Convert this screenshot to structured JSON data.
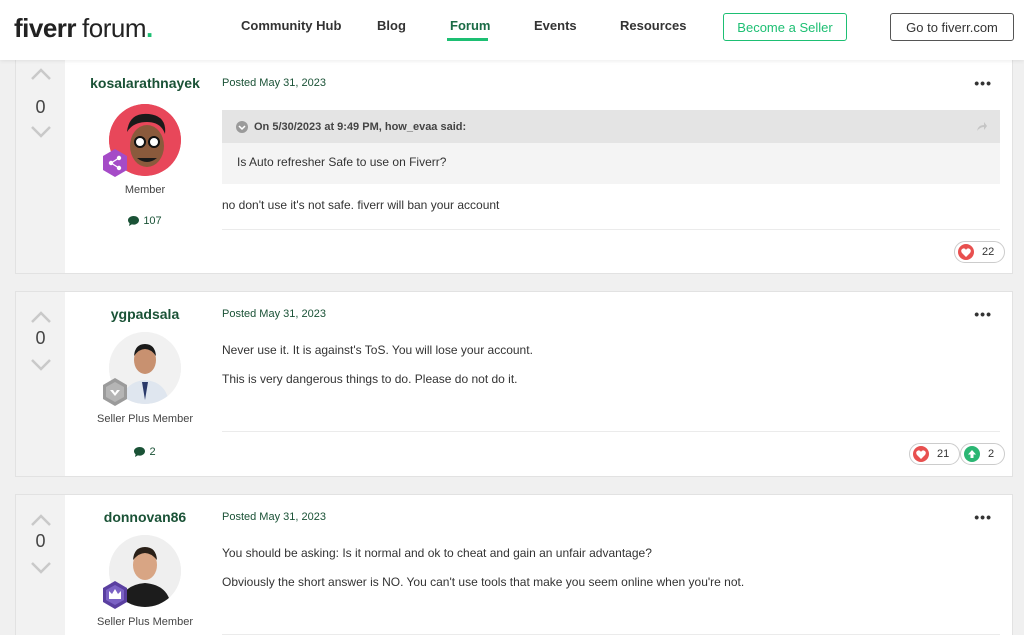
{
  "header": {
    "logo_main": "fiverr",
    "logo_sub": "forum",
    "logo_dot": ".",
    "nav": [
      "Community Hub",
      "Blog",
      "Forum",
      "Events",
      "Resources"
    ],
    "active_nav": "Forum",
    "become_seller": "Become a Seller",
    "go_fiverr": "Go to fiverr.com"
  },
  "colors": {
    "brand": "#1dbf73",
    "author": "#1a5236",
    "heart": "#e8504f",
    "upvote": "#2bb673"
  },
  "posts": [
    {
      "author": "kosalarathnayek",
      "votes": "0",
      "role": "Member",
      "post_count": "107",
      "posted": "Posted May 31, 2023",
      "quote": {
        "header": "On 5/30/2023 at 9:49 PM, how_evaa said:",
        "text": "Is Auto refresher Safe to use on Fiverr?"
      },
      "content": [
        "no don't use it's not safe. fiverr will ban your account"
      ],
      "reactions": {
        "heart": "22"
      }
    },
    {
      "author": "ygpadsala",
      "votes": "0",
      "role": "Seller Plus Member",
      "post_count": "2",
      "posted": "Posted May 31, 2023",
      "content": [
        "Never use it. It is against's ToS. You will lose your account.",
        "This is very dangerous things to do.  Please do not do it."
      ],
      "reactions": {
        "heart": "21",
        "upvote": "2"
      }
    },
    {
      "author": "donnovan86",
      "votes": "0",
      "role": "Seller Plus Member",
      "posted": "Posted May 31, 2023",
      "content": [
        "You should be asking: Is it normal and ok to cheat and gain an unfair advantage?",
        "Obviously the short answer is NO. You can't use tools that make you seem online when you're not."
      ]
    }
  ]
}
